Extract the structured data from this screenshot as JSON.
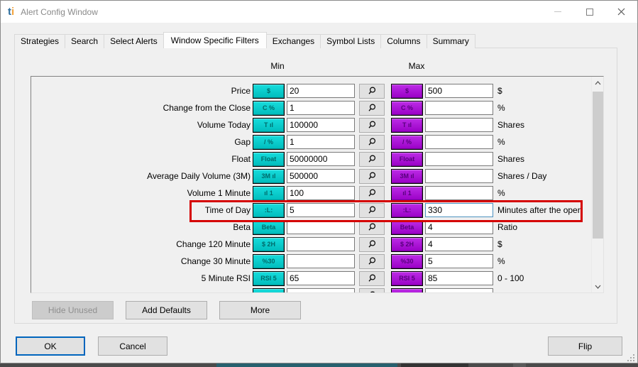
{
  "window": {
    "title": "Alert Config Window",
    "logo_t": "t",
    "logo_i": "i"
  },
  "tabs": [
    {
      "label": "Strategies",
      "active": false
    },
    {
      "label": "Search",
      "active": false
    },
    {
      "label": "Select Alerts",
      "active": false
    },
    {
      "label": "Window Specific Filters",
      "active": true
    },
    {
      "label": "Exchanges",
      "active": false
    },
    {
      "label": "Symbol Lists",
      "active": false
    },
    {
      "label": "Columns",
      "active": false
    },
    {
      "label": "Summary",
      "active": false
    }
  ],
  "filters": {
    "min_header": "Min",
    "max_header": "Max",
    "rows": [
      {
        "label": "Price",
        "icon_name": "price-icon",
        "glyph": "$",
        "min": "20",
        "max": "500",
        "unit": "$"
      },
      {
        "label": "Change from the Close",
        "icon_name": "change-from-close-icon",
        "glyph": "C %",
        "min": "1",
        "max": "",
        "unit": "%"
      },
      {
        "label": "Volume Today",
        "icon_name": "volume-today-icon",
        "glyph": "T ıl",
        "min": "100000",
        "max": "",
        "unit": "Shares"
      },
      {
        "label": "Gap",
        "icon_name": "gap-icon",
        "glyph": "/ %",
        "min": "1",
        "max": "",
        "unit": "%"
      },
      {
        "label": "Float",
        "icon_name": "float-icon",
        "glyph": "Float",
        "min": "50000000",
        "max": "",
        "unit": "Shares"
      },
      {
        "label": "Average Daily Volume (3M)",
        "icon_name": "avg-daily-volume-icon",
        "glyph": "3M ıl",
        "min": "500000",
        "max": "",
        "unit": "Shares / Day"
      },
      {
        "label": "Volume 1 Minute",
        "icon_name": "volume-1-minute-icon",
        "glyph": "ıl 1",
        "min": "100",
        "max": "",
        "unit": "%"
      },
      {
        "label": "Time of Day",
        "icon_name": "clock-icon",
        "glyph": ":L:",
        "min": "5",
        "max": "330",
        "unit": "Minutes after the open",
        "highlighted": true,
        "max_focused": true
      },
      {
        "label": "Beta",
        "icon_name": "beta-icon",
        "glyph": "Beta",
        "min": "",
        "max": "4",
        "unit": "Ratio"
      },
      {
        "label": "Change 120 Minute",
        "icon_name": "change-120-minute-icon",
        "glyph": "$ 2H",
        "min": "",
        "max": "4",
        "unit": "$"
      },
      {
        "label": "Change 30 Minute",
        "icon_name": "change-30-minute-icon",
        "glyph": "%30",
        "min": "",
        "max": "5",
        "unit": "%"
      },
      {
        "label": "5 Minute RSI",
        "icon_name": "rsi-5-minute-icon",
        "glyph": "RSI 5",
        "min": "65",
        "max": "85",
        "unit": "0 - 100"
      },
      {
        "label": "",
        "icon_name": "filter-icon",
        "glyph": "",
        "min": "",
        "max": "",
        "unit": "",
        "partial": true
      }
    ]
  },
  "panel_buttons": {
    "hide_unused": "Hide Unused",
    "add_defaults": "Add Defaults",
    "more": "More"
  },
  "dialog_buttons": {
    "ok": "OK",
    "cancel": "Cancel",
    "flip": "Flip"
  },
  "colors": {
    "min_icon": "#00C4C4",
    "max_icon": "#A400D0",
    "highlight_box": "#D50000",
    "focused_input_border": "#4C91C0",
    "ok_default_border": "#0065BD"
  }
}
